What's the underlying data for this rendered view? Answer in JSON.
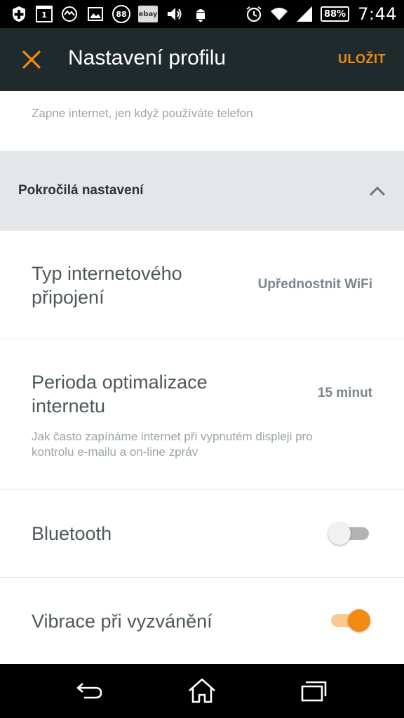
{
  "status_bar": {
    "calendar_day": "1",
    "notification_badge": "88",
    "ebay_label": "ebay",
    "battery": "88%",
    "time": "7:44",
    "icons_left": [
      "plus-icon",
      "calendar-icon",
      "photo-icon",
      "gallery-icon",
      "badge-88-icon",
      "ebay-icon",
      "volume-icon",
      "android-download-icon"
    ],
    "icons_right": [
      "alarm-icon",
      "wifi-icon",
      "signal-icon",
      "battery-icon"
    ]
  },
  "app_bar": {
    "title": "Nastavení profilu",
    "save_label": "ULOŽIT",
    "accent_color": "#f28b14",
    "background_color": "#1f2a2d"
  },
  "content": {
    "helper_top": "Zapne internet, jen když používáte telefon",
    "section": {
      "title": "Pokročilá nastavení",
      "expanded": true
    },
    "rows": {
      "connection_type": {
        "title_line1": "Typ internetového",
        "title_line2": "připojení",
        "value": "Upřednostnit WiFi"
      },
      "optimization_period": {
        "title_line1": "Perioda optimalizace",
        "title_line2": "internetu",
        "value": "15 minut",
        "description_line1": "Jak často zapínáme internet při vypnutém displeji pro",
        "description_line2": "kontrolu e-mailu a on-line zpráv"
      },
      "bluetooth": {
        "title": "Bluetooth",
        "enabled": false
      },
      "ring_vibration": {
        "title": "Vibrace při vyzvánění",
        "enabled": true
      }
    }
  },
  "nav_bar": {
    "icons": [
      "back-icon",
      "home-icon",
      "recent-apps-icon"
    ]
  }
}
